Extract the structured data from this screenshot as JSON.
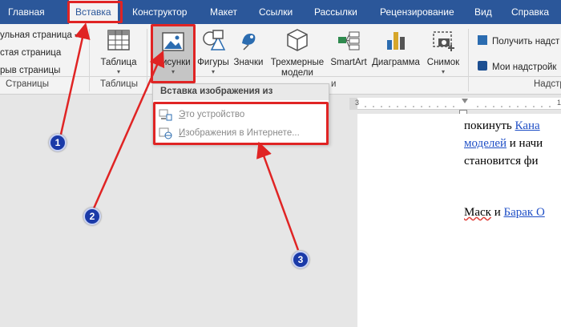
{
  "tabs": [
    {
      "label": "Главная"
    },
    {
      "label": "Вставка"
    },
    {
      "label": "Конструктор"
    },
    {
      "label": "Макет"
    },
    {
      "label": "Ссылки"
    },
    {
      "label": "Рассылки"
    },
    {
      "label": "Рецензирование"
    },
    {
      "label": "Вид"
    },
    {
      "label": "Справка"
    }
  ],
  "pages_group": {
    "items": [
      "ульная страница",
      "стая страница",
      "рыв страницы"
    ],
    "label": "Страницы"
  },
  "tables_group": {
    "button": "Таблица",
    "label": "Таблицы"
  },
  "illustrations_group": {
    "buttons": [
      "Рисунки",
      "Фигуры",
      "Значки",
      "Трехмерные",
      "модели",
      "SmartArt",
      "Диаграмма",
      "Снимок"
    ],
    "label": "и"
  },
  "addins_group": {
    "items": [
      "Получить надст",
      "Мои надстройк"
    ],
    "label": "Надстр"
  },
  "menu": {
    "header": "Вставка изображения из",
    "items": [
      {
        "mnemonic": "Э",
        "rest": "то устройство"
      },
      {
        "mnemonic": "И",
        "rest": "зображения в Интернете..."
      }
    ]
  },
  "ruler": {
    "left_num": "3",
    "right_num": "1"
  },
  "document": {
    "line1_text": "покинуть ",
    "line1_link": "Кана",
    "line2_link": "моделей",
    "line2_text": " и начи",
    "line3_text": "становится фи",
    "line4_text": "Маск",
    "line4_mid": " и ",
    "line4_link": "Барак О"
  },
  "annotations": {
    "badges": [
      "1",
      "2",
      "3"
    ],
    "color": "#e02424",
    "badge_color": "#1a3aa8"
  }
}
